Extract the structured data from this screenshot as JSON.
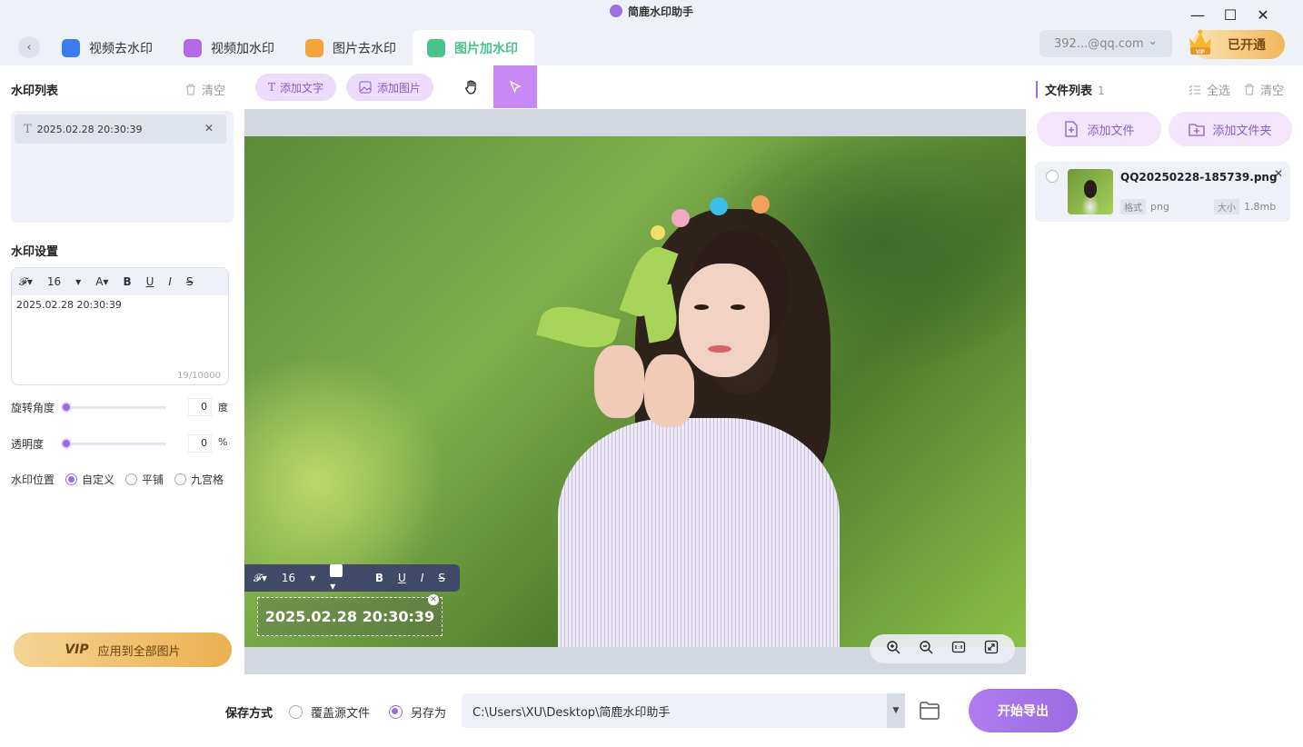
{
  "app": {
    "title": "简鹿水印助手"
  },
  "window": {
    "minimize": "—",
    "maximize": "☐",
    "close": "✕"
  },
  "tabs": [
    {
      "label": "视频去水印",
      "icon": "video-remove-icon",
      "color": "#3b7cf0"
    },
    {
      "label": "视频加水印",
      "icon": "video-add-icon",
      "color": "#b36ae6"
    },
    {
      "label": "图片去水印",
      "icon": "image-remove-icon",
      "color": "#f3a53a"
    },
    {
      "label": "图片加水印",
      "icon": "image-add-icon",
      "color": "#49c28a",
      "active": true
    }
  ],
  "account": {
    "email": "392...@qq.com",
    "vip_label": "已开通",
    "crown_text": "VIP"
  },
  "left": {
    "list_title": "水印列表",
    "clear_label": "清空",
    "items": [
      {
        "text": "2025.02.28 20:30:39"
      }
    ],
    "settings_title": "水印设置",
    "editor": {
      "font_size": "16",
      "text": "2025.02.28 20:30:39",
      "count": "19/10000"
    },
    "rotation": {
      "label": "旋转角度",
      "value": "0",
      "unit": "度",
      "level": 0
    },
    "opacity": {
      "label": "透明度",
      "value": "0",
      "unit": "%",
      "level": 0
    },
    "position": {
      "label": "水印位置",
      "options": [
        {
          "label": "自定义",
          "selected": true
        },
        {
          "label": "平铺",
          "selected": false
        },
        {
          "label": "九宫格",
          "selected": false
        }
      ]
    },
    "apply_vip": "VIP",
    "apply_label": "应用到全部图片"
  },
  "toolbar": {
    "add_text": "添加文字",
    "add_image": "添加图片"
  },
  "canvas": {
    "format_bar": {
      "font_size": "16"
    },
    "watermark_text": "2025.02.28 20:30:39"
  },
  "right": {
    "title": "文件列表",
    "count": "1",
    "select_all": "全选",
    "clear": "清空",
    "add_file": "添加文件",
    "add_folder": "添加文件夹",
    "files": [
      {
        "name": "QQ20250228-185739.png",
        "format_tag": "格式",
        "format": "png",
        "size_tag": "大小",
        "size": "1.8mb"
      }
    ]
  },
  "bottom": {
    "save_label": "保存方式",
    "overwrite": "覆盖源文件",
    "save_as": "另存为",
    "path": "C:\\Users\\XU\\Desktop\\简鹿水印助手",
    "export": "开始导出"
  },
  "colors": {
    "accent": "#9a6be0",
    "active_tab": "#49c28a",
    "vip_gold": "#f2b75a"
  }
}
